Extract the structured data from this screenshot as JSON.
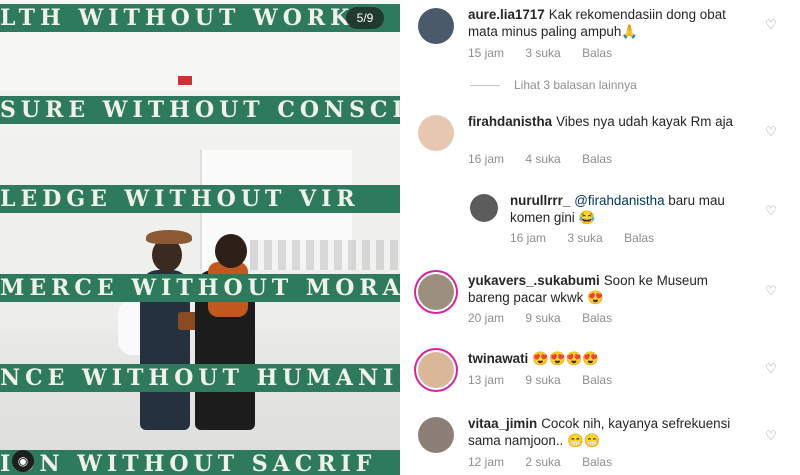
{
  "photo": {
    "counter": "5/9",
    "bands": [
      "LTH WITHOUT WORK",
      "SURE WITHOUT CONSCIE",
      "LEDGE WITHOUT VIR",
      "MERCE WITHOUT MORAL",
      "NCE WITHOUT HUMANI",
      "ION WITHOUT SACRIF"
    ],
    "tag_icon": "user-tag-icon"
  },
  "comments": [
    {
      "user": "aure.lia1717",
      "text": "Kak rekomendasiin dong obat mata minus paling ampuh🙏",
      "time": "15 jam",
      "likes": "3 suka",
      "reply": "Balas",
      "avatar": "avatar-aure"
    },
    {
      "view_replies": "Lihat 3 balasan lainnya"
    },
    {
      "user": "firahdanistha",
      "text": "Vibes nya udah kayak Rm aja",
      "time": "16 jam",
      "likes": "4 suka",
      "reply": "Balas",
      "avatar": "avatar-firah"
    },
    {
      "user": "nurullrrr_",
      "mention": "@firahdanistha",
      "text": " baru mau komen gini 😂",
      "time": "16 jam",
      "likes": "3 suka",
      "reply": "Balas",
      "avatar": "avatar-nurul"
    },
    {
      "user": "yukavers_.sukabumi",
      "text": "Soon ke Museum bareng pacar wkwk 😍",
      "time": "20 jam",
      "likes": "9 suka",
      "reply": "Balas",
      "avatar": "avatar-yuka"
    },
    {
      "user": "twinawati",
      "text": "😍😍😍😍",
      "time": "13 jam",
      "likes": "9 suka",
      "reply": "Balas",
      "avatar": "avatar-twina"
    },
    {
      "user": "vitaa_jimin",
      "text": "Cocok nih, kayanya sefrekuensi sama namjoon.. 😁😁",
      "time": "12 jam",
      "likes": "2 suka",
      "reply": "Balas",
      "avatar": "avatar-vitaa"
    }
  ],
  "colors": {
    "band": "#2e7a5c",
    "story_ring": "#d6249f",
    "meta": "#8e8e8e",
    "text": "#262626"
  }
}
